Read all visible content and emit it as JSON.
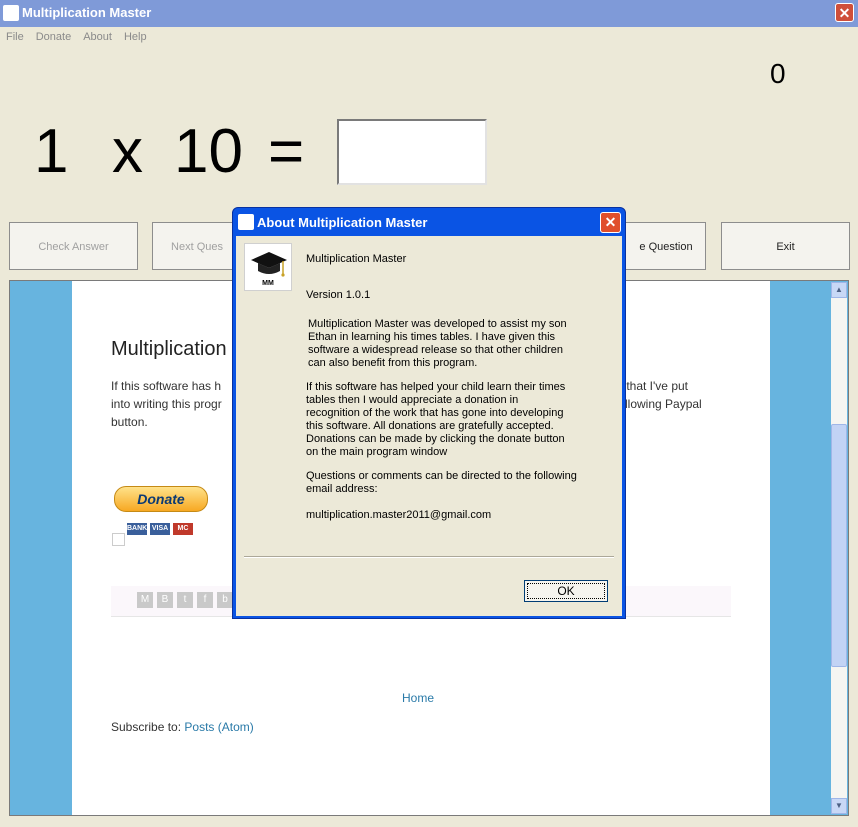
{
  "window": {
    "title": "Multiplication Master"
  },
  "menu": [
    "File",
    "Donate",
    "About",
    "Help"
  ],
  "game": {
    "score": "0",
    "operand_a": "1",
    "operator": "x",
    "operand_b": "10",
    "equals": "=",
    "answer": ""
  },
  "buttons": {
    "check_answer": "Check Answer",
    "next_question": "Next Ques",
    "skip_question": "e Question",
    "exit": "Exit"
  },
  "web": {
    "post_title": "Multiplication",
    "post_text_left": "If this software has h",
    "post_text_left2": "into writing this progr",
    "post_text_left3": "button.",
    "post_text_right": "rk that I've put",
    "post_text_right2": "llowing Paypal",
    "donate_label": "Donate",
    "cards": [
      "BANK",
      "VISA",
      "MC"
    ],
    "home_link": "Home",
    "subscribe_label": "Subscribe to:",
    "subscribe_link": "Posts (Atom)"
  },
  "dialog": {
    "title": "About Multiplication Master",
    "logo_text": "MM",
    "app_name": "Multiplication Master",
    "version": "Version 1.0.1",
    "para1_l1": "Multiplication Master was developed to assist my son",
    "para1_l2": "Ethan in learning his times tables. I have given this",
    "para1_l3": "software a widespread release so that other children",
    "para1_l4": "can also benefit from this program.",
    "para2_l1": "If this software has helped your child learn their times",
    "para2_l2": "tables then I would appreciate a donation in",
    "para2_l3": "recognition of the work that has gone into developing",
    "para2_l4": "this software. All donations are gratefully accepted.",
    "para2_l5": "Donations can be made by clicking the donate button",
    "para2_l6": "on the main program window",
    "para3_l1": "Questions or comments can be directed to the following",
    "para3_l2": "email address:",
    "email": "multiplication.master2011@gmail.com",
    "ok_label": "OK"
  }
}
